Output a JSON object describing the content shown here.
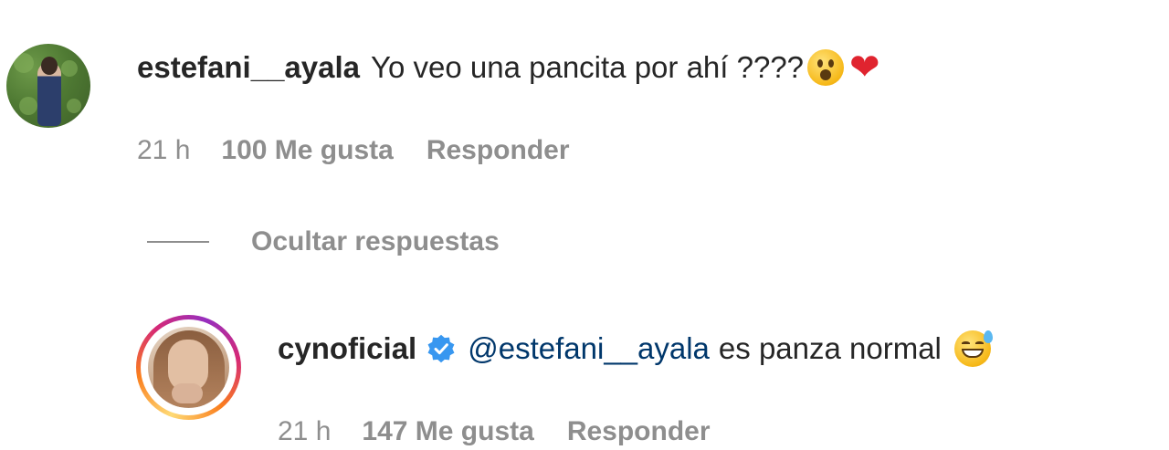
{
  "comment": {
    "username": "estefani__ayala",
    "text": "Yo veo una pancita por ahí ????",
    "emojis": [
      "astonished-face",
      "red-heart"
    ],
    "meta": {
      "time": "21 h",
      "likes": "100 Me gusta",
      "reply_label": "Responder"
    }
  },
  "replies_toggle": {
    "label": "Ocultar respuestas"
  },
  "reply": {
    "username": "cynoficial",
    "verified": true,
    "mention": "@estefani__ayala",
    "text": "es panza normal",
    "emojis": [
      "grinning-face-with-sweat"
    ],
    "meta": {
      "time": "21 h",
      "likes": "147 Me gusta",
      "reply_label": "Responder"
    }
  },
  "colors": {
    "text_primary": "#262626",
    "text_secondary": "#8e8e8e",
    "mention": "#00376b",
    "verified": "#3897f0"
  }
}
